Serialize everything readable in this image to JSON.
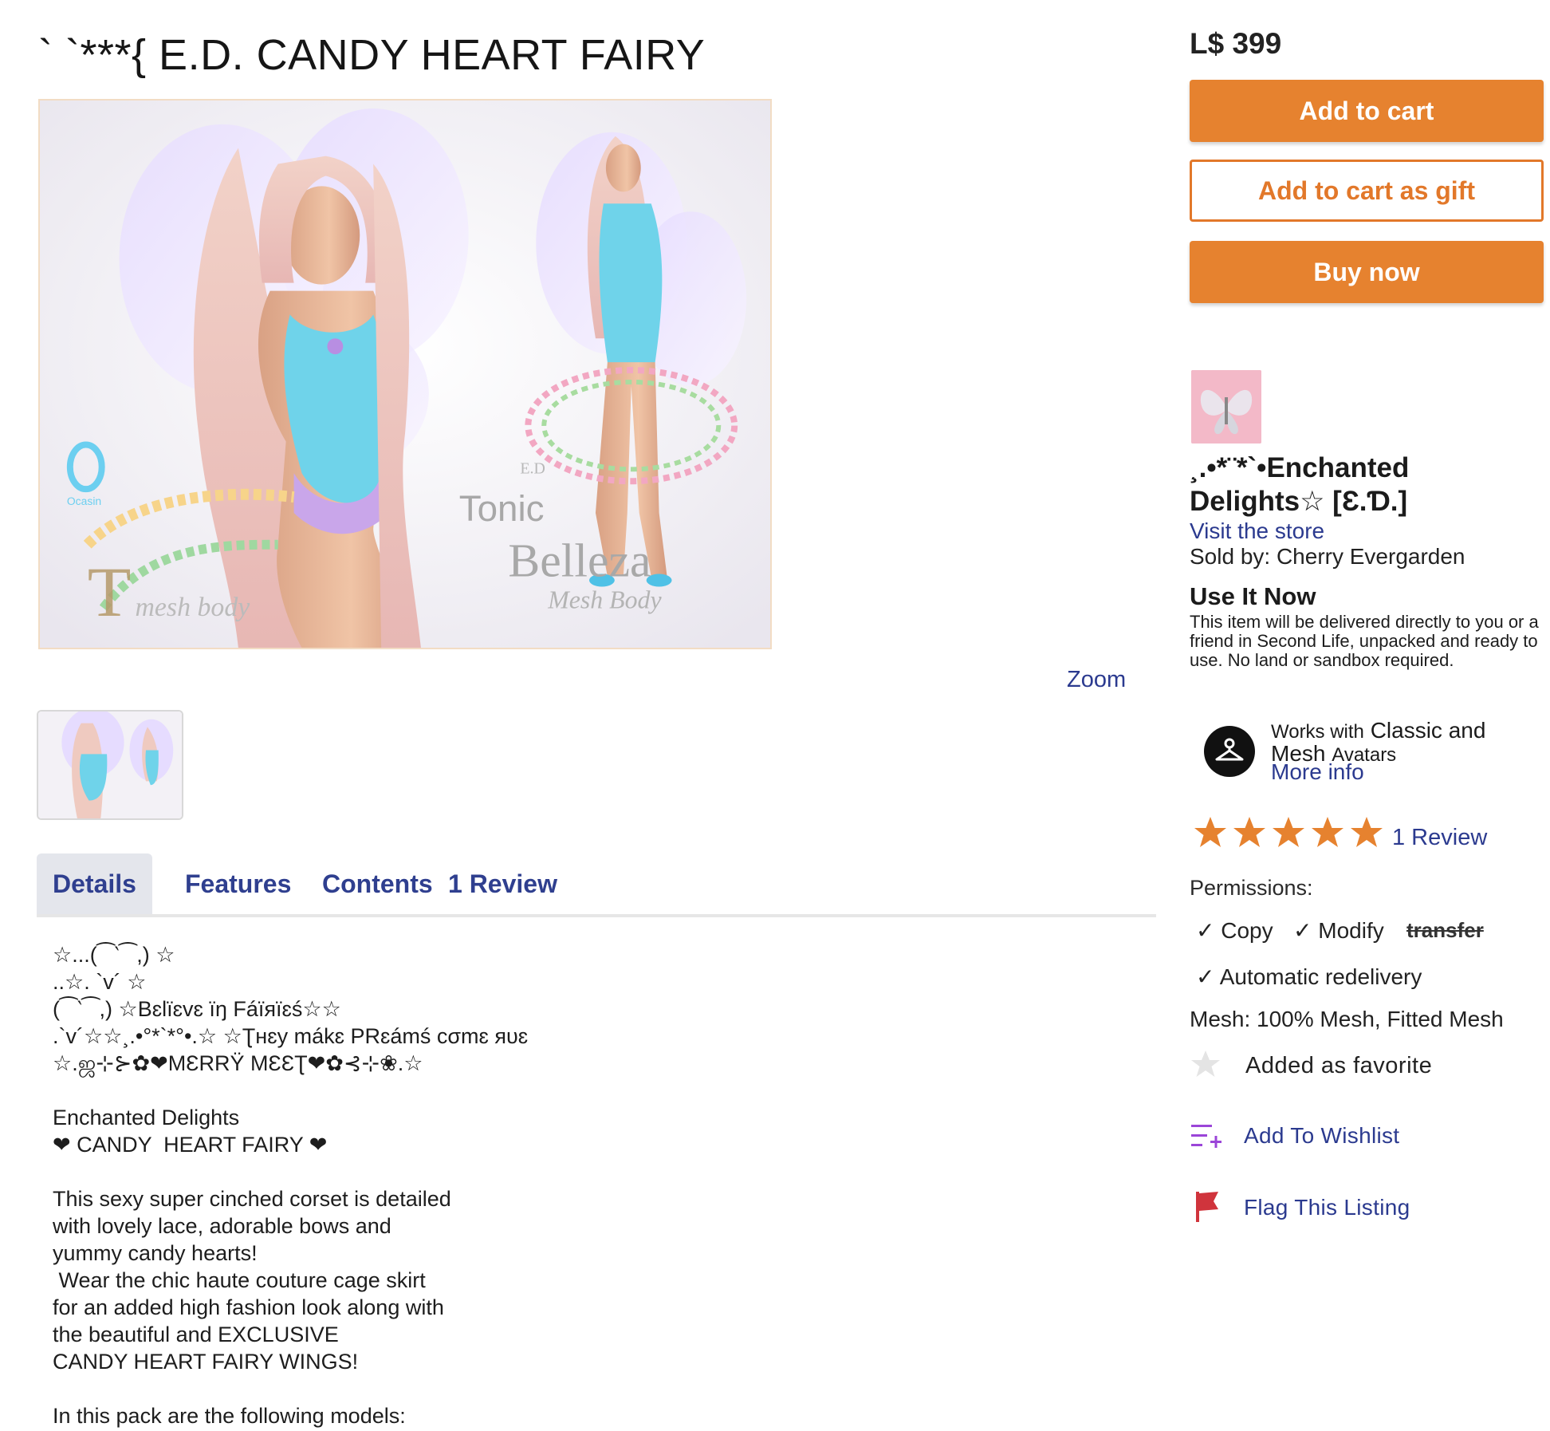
{
  "product": {
    "title": "` `***{ E.D. CANDY HEART FAIRY",
    "zoom_label": "Zoom",
    "image_text": {
      "brand_left": "Ocasin",
      "brand_mid1": "Tonic",
      "brand_mid2": "Belleza",
      "brand_mid3": "Mesh Body",
      "ed_mark": "E.D",
      "mesh_mark": "mesh body"
    }
  },
  "tabs": [
    {
      "label": "Details",
      "active": true
    },
    {
      "label": "Features",
      "active": false
    },
    {
      "label": "Contents",
      "active": false
    },
    {
      "label": "1 Review",
      "active": false
    }
  ],
  "description": {
    "lines": [
      "☆...(⁀‵⁀,) ☆",
      "..☆. `v´ ☆",
      "(⁀‵⁀,) ☆Bɛlïɛvɛ ïŋ Fáïяïɛś☆☆",
      ".`v´☆☆¸.•°*`*°•.☆ ☆Ʈнɛу mákɛ PRɛámś cσmɛ яυɛ",
      "☆.ஜ⊹⊱✿❤MƐRRŸ MƐƐƮ❤✿⊰⊹❀.☆",
      "",
      "Enchanted Delights",
      "❤ CANDY  HEART FAIRY ❤",
      "",
      "This sexy super cinched corset is detailed",
      "with lovely lace, adorable bows and",
      "yummy candy hearts!",
      " Wear the chic haute couture cage skirt",
      "for an added high fashion look along with",
      "the beautiful and EXCLUSIVE",
      "CANDY HEART FAIRY WINGS!",
      "",
      "In this pack are the following models:"
    ]
  },
  "purchase": {
    "price": "L$ 399",
    "add_to_cart": "Add to cart",
    "add_to_cart_gift": "Add to cart as gift",
    "buy_now": "Buy now"
  },
  "store": {
    "name": "¸.•*¨*`•Enchanted Delights☆ [Ɛ.Ɗ.]",
    "visit_label": "Visit the store",
    "sold_by": "Sold by: Cherry Evergarden"
  },
  "use_it_now": {
    "title": "Use It Now",
    "text": "This item will be delivered directly to you or a friend in Second Life, unpacked and ready to use. No land or sandbox required."
  },
  "compatibility": {
    "line1_small": "Works with",
    "line1_big": "Classic and",
    "line2_big": "Mesh",
    "line2_small": "Avatars",
    "more_info": "More info"
  },
  "rating": {
    "stars": 5,
    "review_link": "1 Review"
  },
  "permissions": {
    "label": "Permissions:",
    "copy": "Copy",
    "modify": "Modify",
    "transfer": "transfer",
    "auto_redelivery": "Automatic redelivery",
    "mesh": "Mesh: 100% Mesh, Fitted Mesh"
  },
  "actions": {
    "favorite": "Added as favorite",
    "wishlist": "Add To Wishlist",
    "flag": "Flag This Listing"
  },
  "colors": {
    "accent_orange": "#e6822f",
    "link_blue": "#2b3a8f",
    "star_orange": "#e6822f",
    "flag_red": "#d0343c",
    "wishlist_purple": "#9b45d8"
  },
  "icons": {
    "avatar": "hanger-icon",
    "favorite": "star-icon",
    "wishlist": "wishlist-add-icon",
    "flag": "flag-icon"
  }
}
